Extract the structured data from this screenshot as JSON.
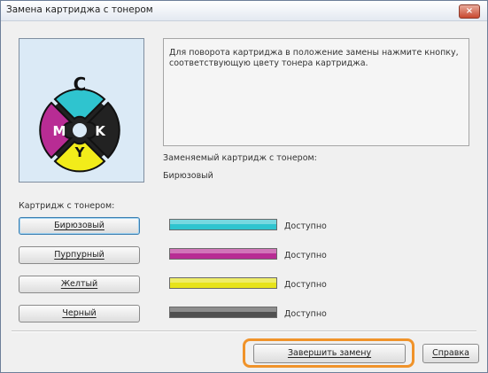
{
  "window": {
    "title": "Замена картриджа с тонером",
    "close_glyph": "×"
  },
  "preview": {
    "letters": {
      "c": "C",
      "m": "M",
      "k": "K",
      "y": "Y"
    },
    "colors": {
      "cyan": "#2fc4cf",
      "magenta": "#b82c94",
      "yellow": "#f2ec1a",
      "black": "#222222"
    }
  },
  "message": "Для поворота картриджа в положение замены нажмите кнопку, соответствующую цвету тонера картриджа.",
  "replaced": {
    "label": "Заменяемый картридж с тонером:",
    "value": "Бирюзовый"
  },
  "cartridges": {
    "label": "Картридж с тонером:",
    "items": [
      {
        "name": "Бирюзовый",
        "status": "Доступно",
        "color": "#2fc4cf"
      },
      {
        "name": "Пурпурный",
        "status": "Доступно",
        "color": "#b82c94"
      },
      {
        "name": "Желтый",
        "status": "Доступно",
        "color": "#e7e31a"
      },
      {
        "name": "Черный",
        "status": "Доступно",
        "color": "#505050"
      }
    ]
  },
  "buttons": {
    "finish": "Завершить замену",
    "help": "Справка"
  }
}
